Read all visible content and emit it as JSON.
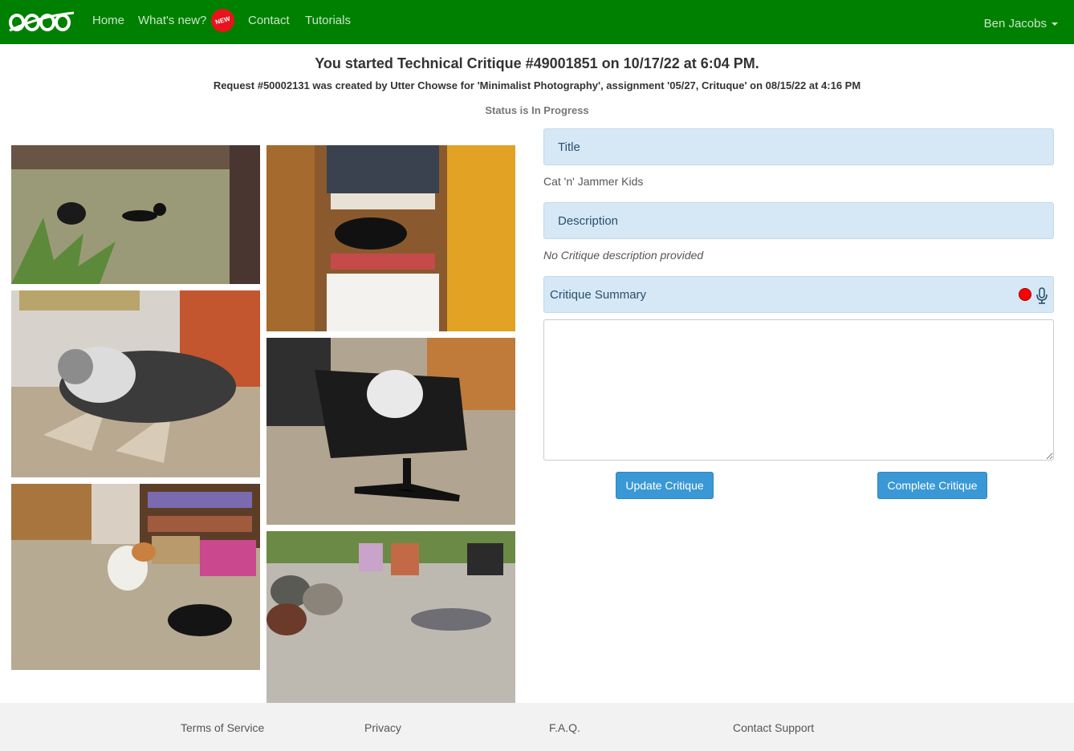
{
  "nav": {
    "items": [
      {
        "label": "Home"
      },
      {
        "label": "What's new?"
      },
      {
        "label": "Contact"
      },
      {
        "label": "Tutorials"
      }
    ],
    "new_badge": "NEW",
    "user": "Ben Jacobs",
    "brand_color": "#008000",
    "badge_color": "#e8131b"
  },
  "header": {
    "title": "You started Technical Critique #49001851 on 10/17/22 at 6:04 PM.",
    "request": "Request #50002131 was created by Utter Chowse for 'Minimalist Photography', assignment '05/27, Crituque' on 08/15/22 at 4:16 PM",
    "status": "Status is In Progress"
  },
  "photos": [
    {
      "subject": "black cat in grass yard"
    },
    {
      "subject": "black cat in closet shelf"
    },
    {
      "subject": "tabby cat on carpet by window"
    },
    {
      "subject": "white cat on office chair"
    },
    {
      "subject": "cats on carpet near bookshelf"
    },
    {
      "subject": "grey cat on patio"
    }
  ],
  "critique": {
    "title_label": "Title",
    "title_value": "Cat 'n' Jammer Kids",
    "description_label": "Description",
    "description_value": "No Critique description provided",
    "summary_label": "Critique Summary",
    "summary_value": "",
    "icons": {
      "record": "record-dot-icon",
      "mic": "microphone-icon"
    },
    "panel_color": "#d6e8f5"
  },
  "buttons": {
    "update": "Update Critique",
    "complete": "Complete Critique",
    "color": "#3a98d6"
  },
  "footer": {
    "links": [
      {
        "label": "Terms of Service"
      },
      {
        "label": "Privacy"
      },
      {
        "label": "F.A.Q."
      },
      {
        "label": "Contact Support"
      }
    ]
  }
}
